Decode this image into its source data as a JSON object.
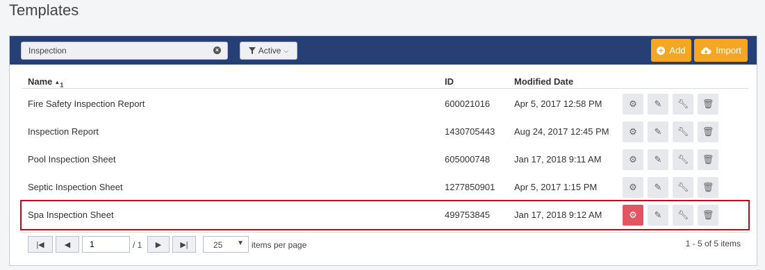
{
  "page": {
    "title": "Templates"
  },
  "toolbar": {
    "search_value": "Inspection",
    "filter_label": "Active",
    "add_label": "Add",
    "import_label": "Import"
  },
  "table": {
    "columns": {
      "name": "Name",
      "sort_index": "1",
      "id": "ID",
      "modified": "Modified Date"
    },
    "rows": [
      {
        "name": "Fire Safety Inspection Report",
        "id": "600021016",
        "modified": "Apr 5, 2017 12:58 PM"
      },
      {
        "name": "Inspection Report",
        "id": "1430705443",
        "modified": "Aug 24, 2017 12:45 PM"
      },
      {
        "name": "Pool Inspection Sheet",
        "id": "605000748",
        "modified": "Jan 17, 2018 9:11 AM"
      },
      {
        "name": "Septic Inspection Sheet",
        "id": "1277850901",
        "modified": "Apr 5, 2017 1:15 PM"
      },
      {
        "name": "Spa Inspection Sheet",
        "id": "499753845",
        "modified": "Jan 17, 2018 9:12 AM"
      }
    ]
  },
  "pager": {
    "current_page": "1",
    "of_pages": "/ 1",
    "per_page": "25",
    "items_per_page_label": "items per page",
    "summary": "1 - 5 of 5 items"
  },
  "colors": {
    "toolbar_bg": "#263f75",
    "accent_orange": "#f5a623",
    "selected_outline": "#d0021b",
    "active_action": "#e25563"
  }
}
